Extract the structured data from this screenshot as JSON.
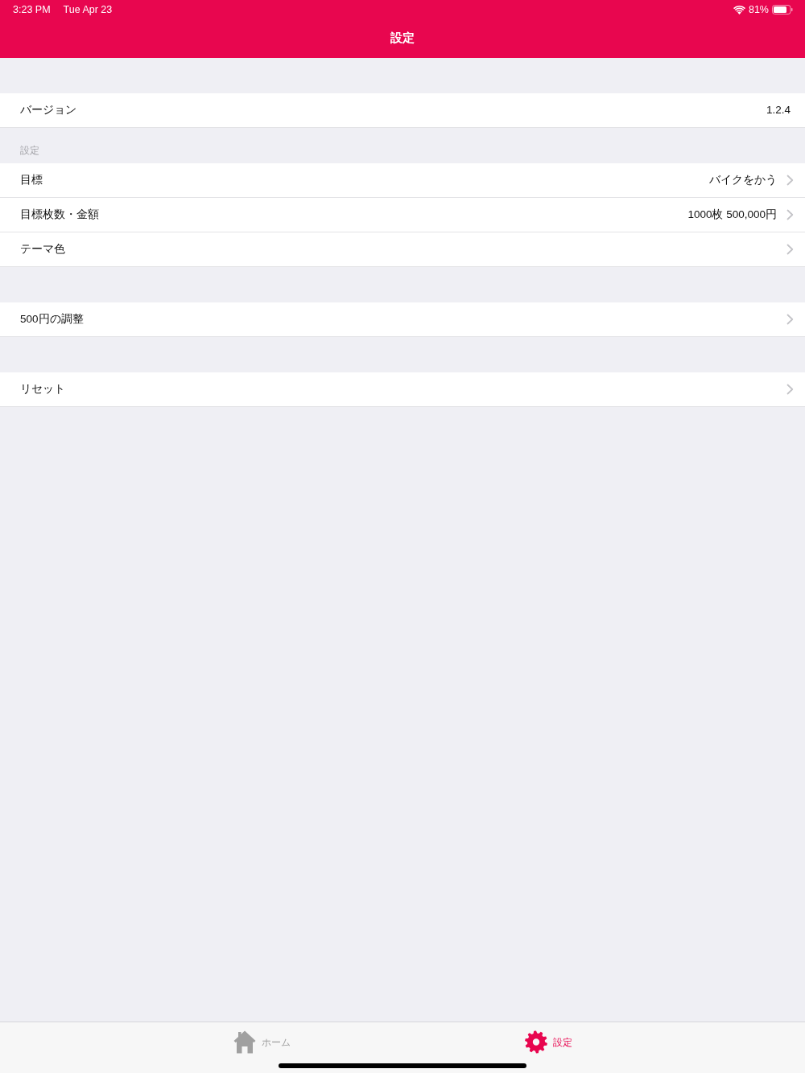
{
  "status_bar": {
    "time": "3:23 PM",
    "date": "Tue Apr 23",
    "battery": "81%"
  },
  "nav_bar": {
    "title": "設定"
  },
  "sections": [
    {
      "rows": [
        {
          "label": "バージョン",
          "value": "1.2.4",
          "disclosure": false
        }
      ]
    },
    {
      "header": "設定",
      "rows": [
        {
          "label": "目標",
          "value": "バイクをかう",
          "disclosure": true
        },
        {
          "label": "目標枚数・金額",
          "value": "1000枚 500,000円",
          "disclosure": true
        },
        {
          "label": "テーマ色",
          "disclosure": true
        }
      ]
    },
    {
      "rows": [
        {
          "label": "500円の調整",
          "disclosure": true
        }
      ]
    },
    {
      "rows": [
        {
          "label": "リセット",
          "disclosure": true
        }
      ]
    }
  ],
  "tab_bar": [
    {
      "kind": "home",
      "label": "ホーム",
      "selected": false
    },
    {
      "kind": "settings",
      "label": "設定",
      "selected": true
    }
  ]
}
